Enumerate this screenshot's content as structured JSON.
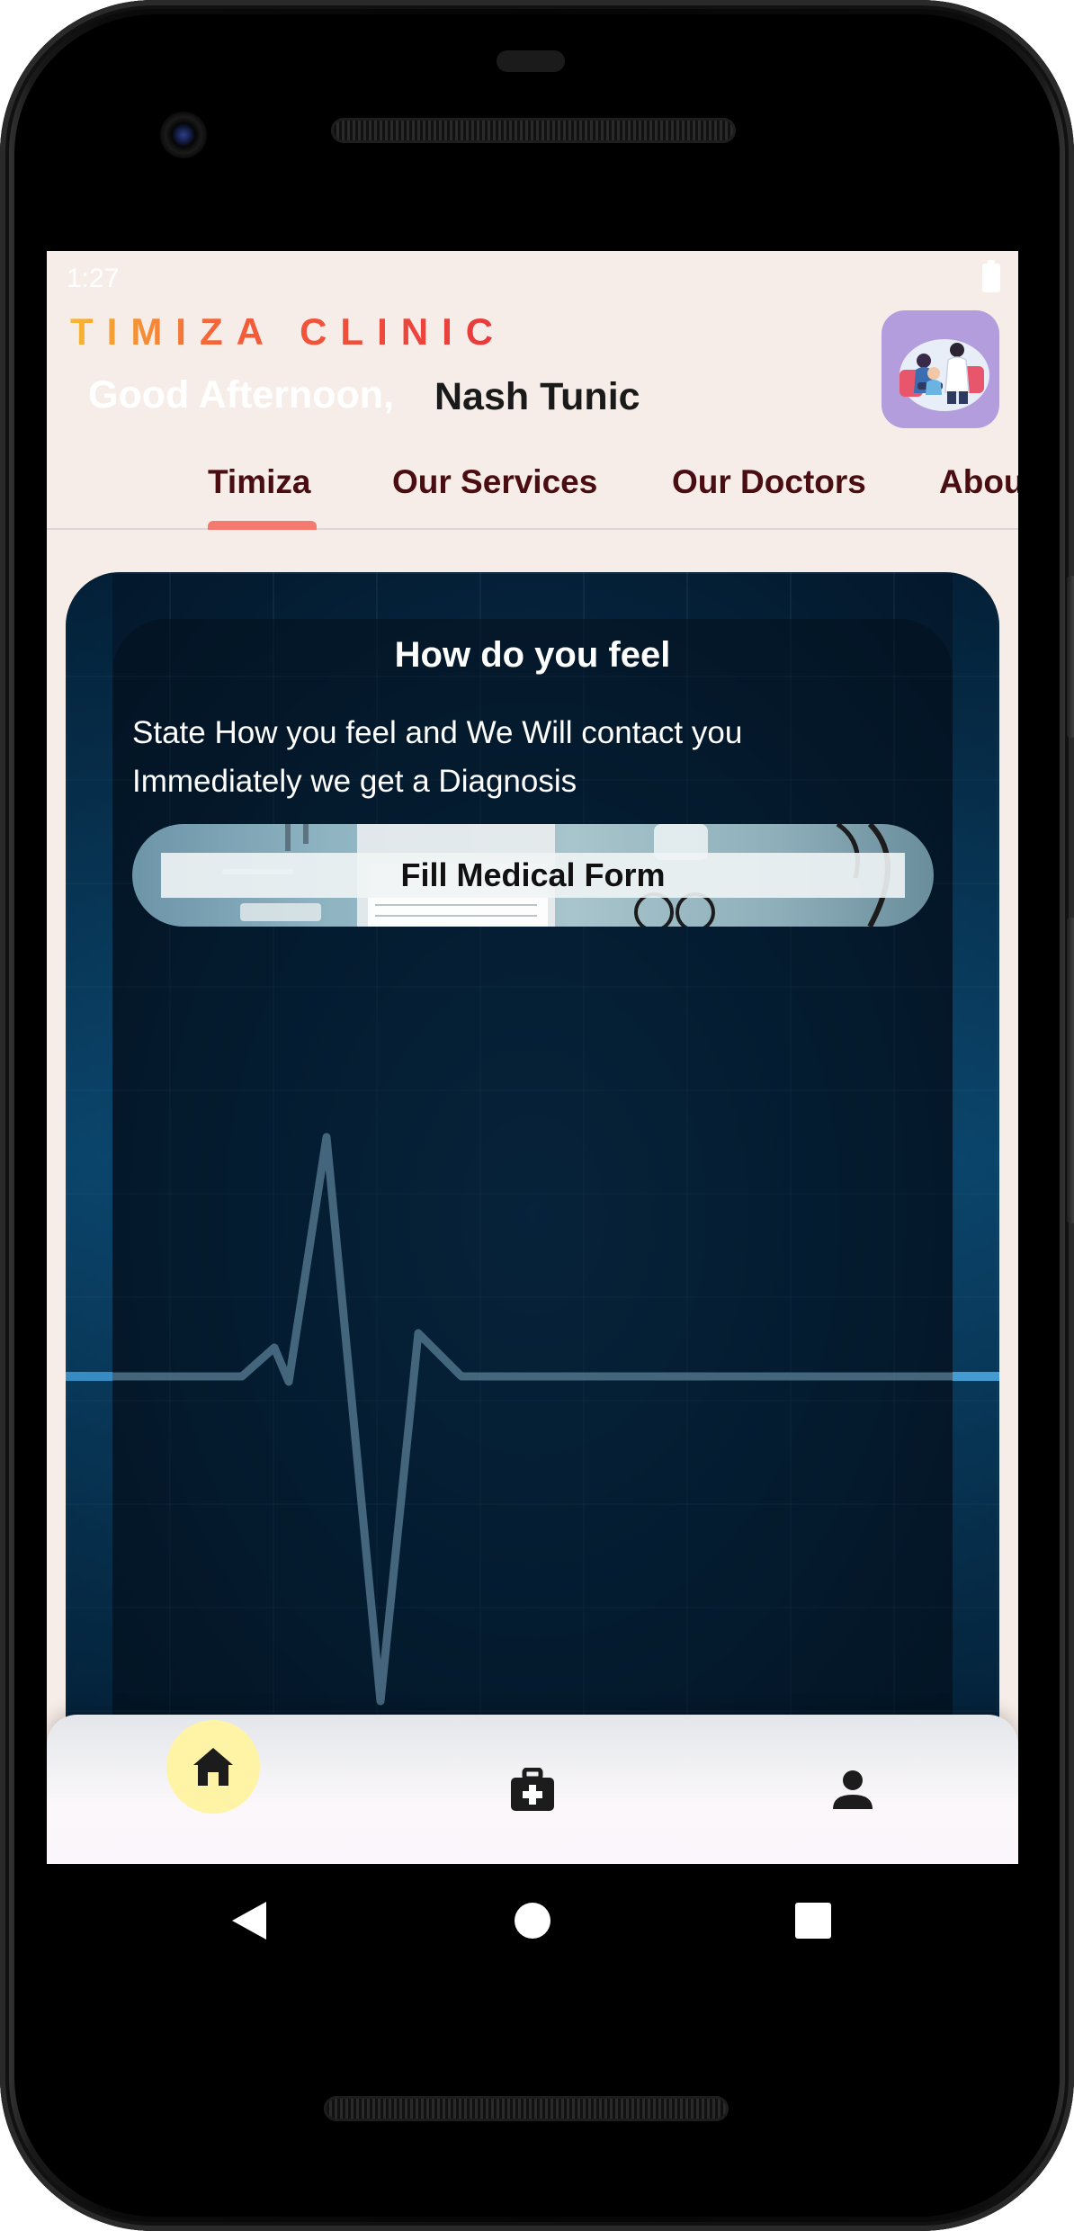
{
  "status_bar": {
    "time": "1:27",
    "battery_icon": "battery-icon"
  },
  "header": {
    "brand": "TIMIZA CLINIC",
    "greeting": "Good Afternoon,",
    "user_name": "Nash Tunic",
    "avatar_icon": "doctor-consultation-illustration"
  },
  "tabs": [
    {
      "label": "Timiza",
      "selected": true
    },
    {
      "label": "Our Services",
      "selected": false
    },
    {
      "label": "Our Doctors",
      "selected": false
    },
    {
      "label": "About",
      "selected": false
    }
  ],
  "hero": {
    "title": "How do you feel",
    "description_line1": "State How you feel and We Will contact you",
    "description_line2": "Immediately we get a Diagnosis",
    "button_label": "Fill Medical Form",
    "background_icon": "heartbeat-ecg-background"
  },
  "bottom_nav": [
    {
      "icon": "home-icon",
      "active": true
    },
    {
      "icon": "medical-kit-icon",
      "active": false
    },
    {
      "icon": "person-icon",
      "active": false
    }
  ],
  "system_nav": {
    "back_icon": "back-triangle-icon",
    "home_icon": "home-circle-icon",
    "recents_icon": "recents-square-icon"
  },
  "colors": {
    "screen_background": "#f7ede8",
    "brand_gradient_start": "#f7b733",
    "brand_gradient_end": "#e8383d",
    "tab_text": "#4a0d12",
    "tab_indicator": "#f4796e",
    "avatar_background": "#b49ddc",
    "hero_background": "#062a47",
    "active_nav_background": "#fff3a6"
  }
}
